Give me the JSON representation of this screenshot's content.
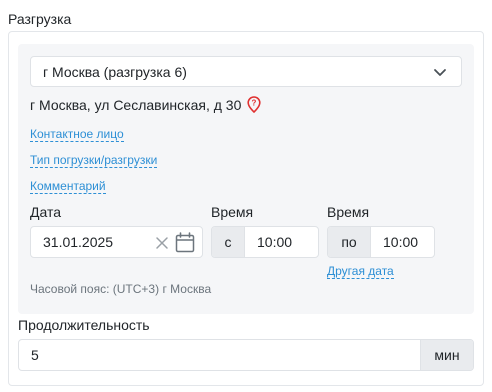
{
  "section": {
    "title": "Разгрузка"
  },
  "select": {
    "value": "г Москва (разгрузка 6)"
  },
  "address": {
    "text": "г Москва, ул Сеславинская, д 30"
  },
  "links": {
    "contact": "Контактное лицо",
    "load_type": "Тип погрузки/разгрузки",
    "comment": "Комментарий",
    "other_date": "Другая дата"
  },
  "date": {
    "label": "Дата",
    "value": "31.01.2025"
  },
  "time_from": {
    "label": "Время",
    "prefix": "с",
    "value": "10:00"
  },
  "time_to": {
    "label": "Время",
    "prefix": "по",
    "value": "10:00"
  },
  "timezone": {
    "text": "Часовой пояс: (UTC+3) г Москва"
  },
  "duration": {
    "label": "Продолжительность",
    "value": "5",
    "unit": "мин"
  },
  "colors": {
    "link": "#2d8fd5",
    "pin": "#e03131",
    "panel": "#f5f6f8"
  }
}
